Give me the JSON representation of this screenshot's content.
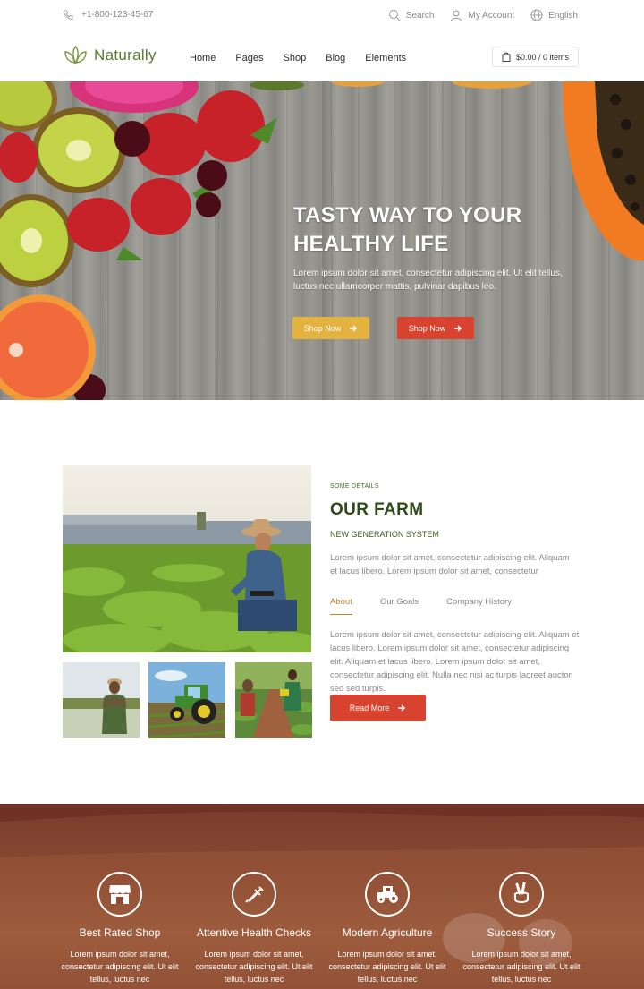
{
  "topbar": {
    "phone": "+1-800-123-45-67",
    "search_label": "Search",
    "account_label": "My Account",
    "language_label": "English"
  },
  "brand": {
    "name": "Naturally",
    "accent": "#5a7a2c"
  },
  "nav": {
    "items": [
      {
        "label": "Home"
      },
      {
        "label": "Pages"
      },
      {
        "label": "Shop"
      },
      {
        "label": "Blog"
      },
      {
        "label": "Elements"
      }
    ],
    "cart_label": "$0.00 / 0 items"
  },
  "hero": {
    "title_line1": "TASTY WAY TO YOUR",
    "title_line2": "HEALTHY LIFE",
    "text": "Lorem ipsum dolor sit amet, consectetur adipiscing elit. Ut elit tellus, luctus nec ullamcorper mattis, pulvinar dapibus leo.",
    "button1": "Shop Now",
    "button2": "Shop Now",
    "colors": {
      "yellow": "#e3b23f",
      "red": "#d8432f"
    }
  },
  "about": {
    "kicker": "SOME DETAILS",
    "title": "OUR FARM",
    "subtitle": "NEW GENERATION SYSTEM",
    "intro": "Lorem ipsum dolor sit amet, consectetur adipiscing elit. Aliquam et lacus libero. Lorem ipsum dolor sit amet, consectetur",
    "tabs": [
      {
        "label": "About",
        "active": true
      },
      {
        "label": "Our Goals",
        "active": false
      },
      {
        "label": "Company History",
        "active": false
      }
    ],
    "tab_text": "Lorem ipsum dolor sit amet, consectetur adipiscing elit. Aliquam et lacus libero. Lorem ipsum dolor sit amet, consectetur adipiscing elit. Aliquam et lacus libero. Lorem ipsum dolor sit amet, consectetur adipiscing elit. Nulla nec nisi ac turpis laoreet auctor sed sed turpis.",
    "button": "Read More"
  },
  "features": [
    {
      "icon": "shop-icon",
      "title": "Best Rated Shop",
      "text": "Lorem ipsum dolor sit amet, consectetur adipiscing elit. Ut elit tellus, luctus nec"
    },
    {
      "icon": "syringe-icon",
      "title": "Attentive Health Checks",
      "text": "Lorem ipsum dolor sit amet, consectetur adipiscing elit. Ut elit tellus, luctus nec"
    },
    {
      "icon": "tractor-icon",
      "title": "Modern Agriculture",
      "text": "Lorem ipsum dolor sit amet, consectetur adipiscing elit. Ut elit tellus, luctus nec"
    },
    {
      "icon": "peace-hand-icon",
      "title": "Success Story",
      "text": "Lorem ipsum dolor sit amet, consectetur adipiscing elit. Ut elit tellus, luctus nec"
    }
  ]
}
